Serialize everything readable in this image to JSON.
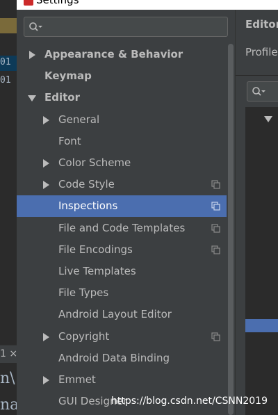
{
  "window": {
    "title": "Settings"
  },
  "background_editor": {
    "line_numbers": [
      "01",
      "01"
    ],
    "tab_fragment": "1 ×",
    "code_fragments": [
      "n\\",
      "na"
    ]
  },
  "search": {
    "placeholder": ""
  },
  "tree": [
    {
      "label": "Appearance & Behavior",
      "level": 0,
      "expander": "collapsed",
      "bold": true,
      "selected": false,
      "project_icon": false
    },
    {
      "label": "Keymap",
      "level": 0,
      "expander": "none",
      "bold": true,
      "selected": false,
      "project_icon": false
    },
    {
      "label": "Editor",
      "level": 0,
      "expander": "expanded",
      "bold": true,
      "selected": false,
      "project_icon": false
    },
    {
      "label": "General",
      "level": 1,
      "expander": "collapsed",
      "bold": false,
      "selected": false,
      "project_icon": false
    },
    {
      "label": "Font",
      "level": 1,
      "expander": "none",
      "bold": false,
      "selected": false,
      "project_icon": false
    },
    {
      "label": "Color Scheme",
      "level": 1,
      "expander": "collapsed",
      "bold": false,
      "selected": false,
      "project_icon": false
    },
    {
      "label": "Code Style",
      "level": 1,
      "expander": "collapsed",
      "bold": false,
      "selected": false,
      "project_icon": true
    },
    {
      "label": "Inspections",
      "level": 1,
      "expander": "none",
      "bold": false,
      "selected": true,
      "project_icon": true
    },
    {
      "label": "File and Code Templates",
      "level": 1,
      "expander": "none",
      "bold": false,
      "selected": false,
      "project_icon": true
    },
    {
      "label": "File Encodings",
      "level": 1,
      "expander": "none",
      "bold": false,
      "selected": false,
      "project_icon": true
    },
    {
      "label": "Live Templates",
      "level": 1,
      "expander": "none",
      "bold": false,
      "selected": false,
      "project_icon": false
    },
    {
      "label": "File Types",
      "level": 1,
      "expander": "none",
      "bold": false,
      "selected": false,
      "project_icon": false
    },
    {
      "label": "Android Layout Editor",
      "level": 1,
      "expander": "none",
      "bold": false,
      "selected": false,
      "project_icon": false
    },
    {
      "label": "Copyright",
      "level": 1,
      "expander": "collapsed",
      "bold": false,
      "selected": false,
      "project_icon": true
    },
    {
      "label": "Android Data Binding",
      "level": 1,
      "expander": "none",
      "bold": false,
      "selected": false,
      "project_icon": false
    },
    {
      "label": "Emmet",
      "level": 1,
      "expander": "collapsed",
      "bold": false,
      "selected": false,
      "project_icon": false
    },
    {
      "label": "GUI Designer",
      "level": 1,
      "expander": "none",
      "bold": false,
      "selected": false,
      "project_icon": false
    }
  ],
  "right_panel": {
    "breadcrumb": "Editor",
    "profile_label": "Profile"
  },
  "watermark": "https://blog.csdn.net/CSNN2019",
  "colors": {
    "panel_bg": "#3c3f41",
    "selection": "#4b6eaf",
    "text": "#bbbbbb",
    "editor_bg": "#2b2b2b"
  }
}
